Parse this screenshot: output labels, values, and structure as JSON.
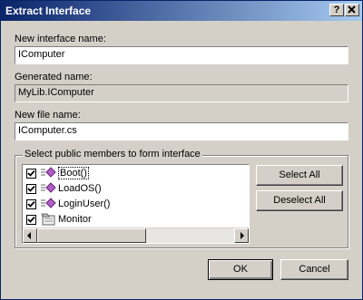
{
  "window": {
    "title": "Extract Interface",
    "help_label": "?",
    "close_label": "✕"
  },
  "fields": {
    "interface_name": {
      "label": "New interface name:",
      "value": "IComputer"
    },
    "generated_name": {
      "label": "Generated name:",
      "value": "MyLib.IComputer"
    },
    "file_name": {
      "label": "New file name:",
      "value": "IComputer.cs"
    }
  },
  "members": {
    "group_label": "Select public members to form interface",
    "items": [
      {
        "label": "Boot()",
        "checked": true,
        "icon": "method-icon",
        "focused": true
      },
      {
        "label": "LoadOS()",
        "checked": true,
        "icon": "method-icon"
      },
      {
        "label": "LoginUser()",
        "checked": true,
        "icon": "method-icon"
      },
      {
        "label": "Monitor",
        "checked": true,
        "icon": "property-icon"
      }
    ],
    "select_all_label": "Select All",
    "deselect_all_label": "Deselect All"
  },
  "buttons": {
    "ok_label": "OK",
    "cancel_label": "Cancel"
  }
}
